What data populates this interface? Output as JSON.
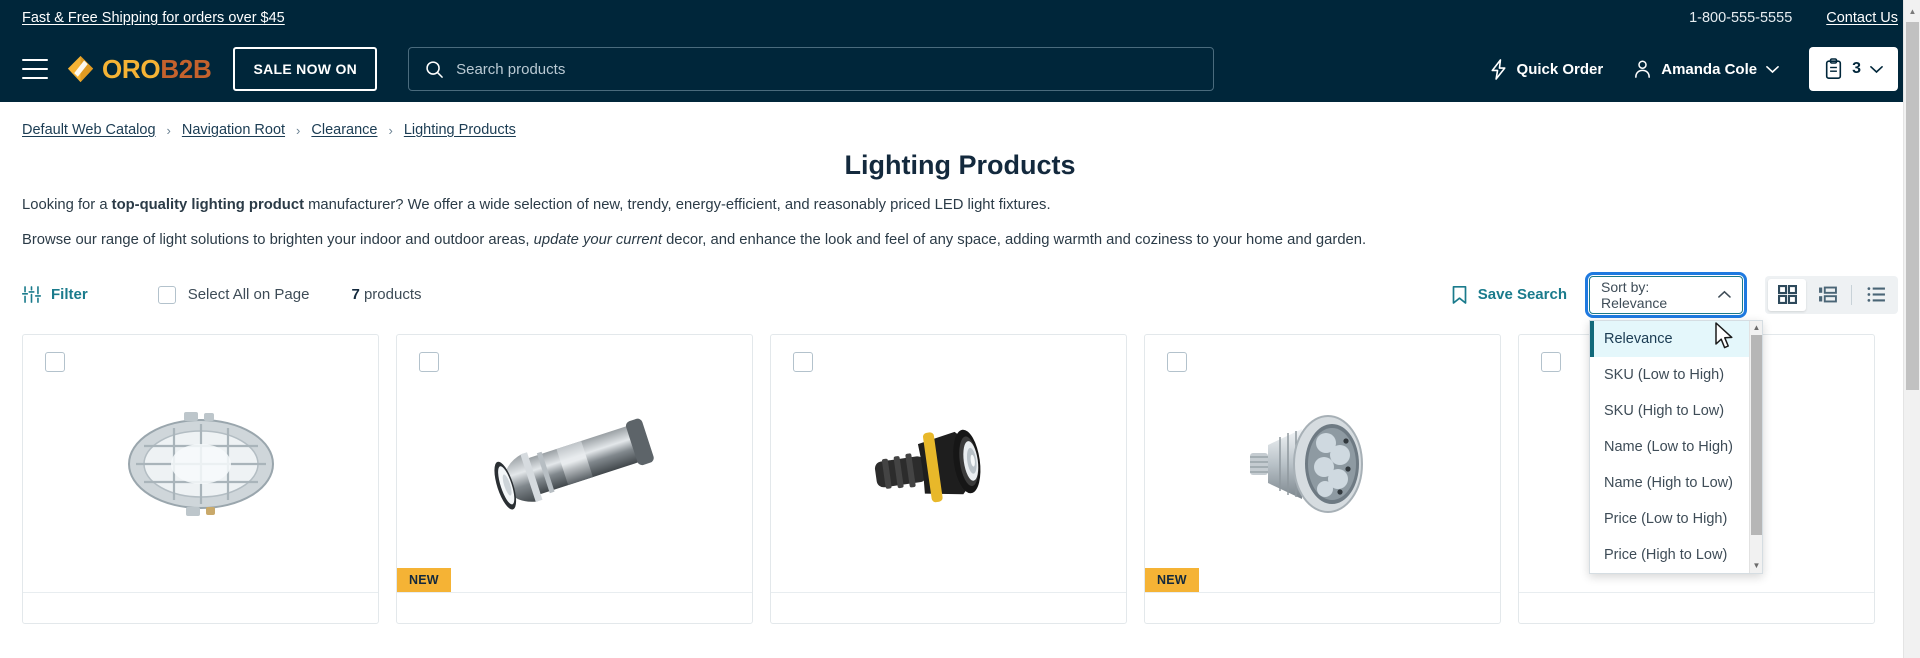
{
  "topbar": {
    "shipping_text": "Fast & Free Shipping for orders over $45",
    "phone": "1-800-555-5555",
    "contact_label": "Contact Us"
  },
  "header": {
    "logo_oro": "ORO",
    "logo_b2b": "B2B",
    "sale_label": "SALE NOW ON",
    "search_placeholder": "Search products",
    "search_value": "",
    "quick_order_label": "Quick Order",
    "account_name": "Amanda Cole",
    "cart_count": "3"
  },
  "breadcrumb": {
    "items": [
      {
        "label": "Default Web Catalog"
      },
      {
        "label": "Navigation Root"
      },
      {
        "label": "Clearance"
      },
      {
        "label": "Lighting Products"
      }
    ],
    "separator": "›"
  },
  "page": {
    "title": "Lighting Products",
    "intro_1_a": "Looking for a ",
    "intro_1_b": "top-quality lighting product",
    "intro_1_c": " manufacturer? We offer a wide selection of new, trendy, energy-efficient, and reasonably priced LED light fixtures.",
    "intro_2_a": "Browse our range of light solutions to brighten your indoor and outdoor areas, ",
    "intro_2_b": "update your current",
    "intro_2_c": " decor, and enhance the look and feel of any space, adding warmth and coziness to your home and garden."
  },
  "toolbar": {
    "filter_label": "Filter",
    "select_all_label": "Select All on Page",
    "product_count": "7",
    "product_count_word": "products",
    "save_search_label": "Save Search",
    "sort_prefix": "Sort by:",
    "sort_value": "Relevance",
    "view_modes": [
      {
        "name": "grid-view",
        "active": true
      },
      {
        "name": "gallery-view",
        "active": false
      },
      {
        "name": "list-view",
        "active": false
      }
    ]
  },
  "sort_menu": {
    "open": true,
    "options": [
      {
        "label": "Relevance",
        "selected": true
      },
      {
        "label": "SKU (Low to High)",
        "selected": false
      },
      {
        "label": "SKU (High to Low)",
        "selected": false
      },
      {
        "label": "Name (Low to High)",
        "selected": false
      },
      {
        "label": "Name (High to Low)",
        "selected": false
      },
      {
        "label": "Price (Low to High)",
        "selected": false
      },
      {
        "label": "Price (High to Low)",
        "selected": false
      }
    ]
  },
  "products": [
    {
      "image": "oval-bulkhead-lamp",
      "badge": ""
    },
    {
      "image": "silver-flashlight",
      "badge": "NEW"
    },
    {
      "image": "black-yellow-torch",
      "badge": ""
    },
    {
      "image": "led-spot-bulb",
      "badge": "NEW"
    },
    {
      "image": "partial-product",
      "badge": ""
    }
  ],
  "colors": {
    "header_bg": "#00263a",
    "accent_teal": "#1a7b8c",
    "badge_yellow": "#f5b335",
    "logo_oro": "#f5b335",
    "logo_b2b": "#c4622d",
    "focus_blue": "#1f7ae0",
    "menu_highlight": "#e4f7fb"
  }
}
